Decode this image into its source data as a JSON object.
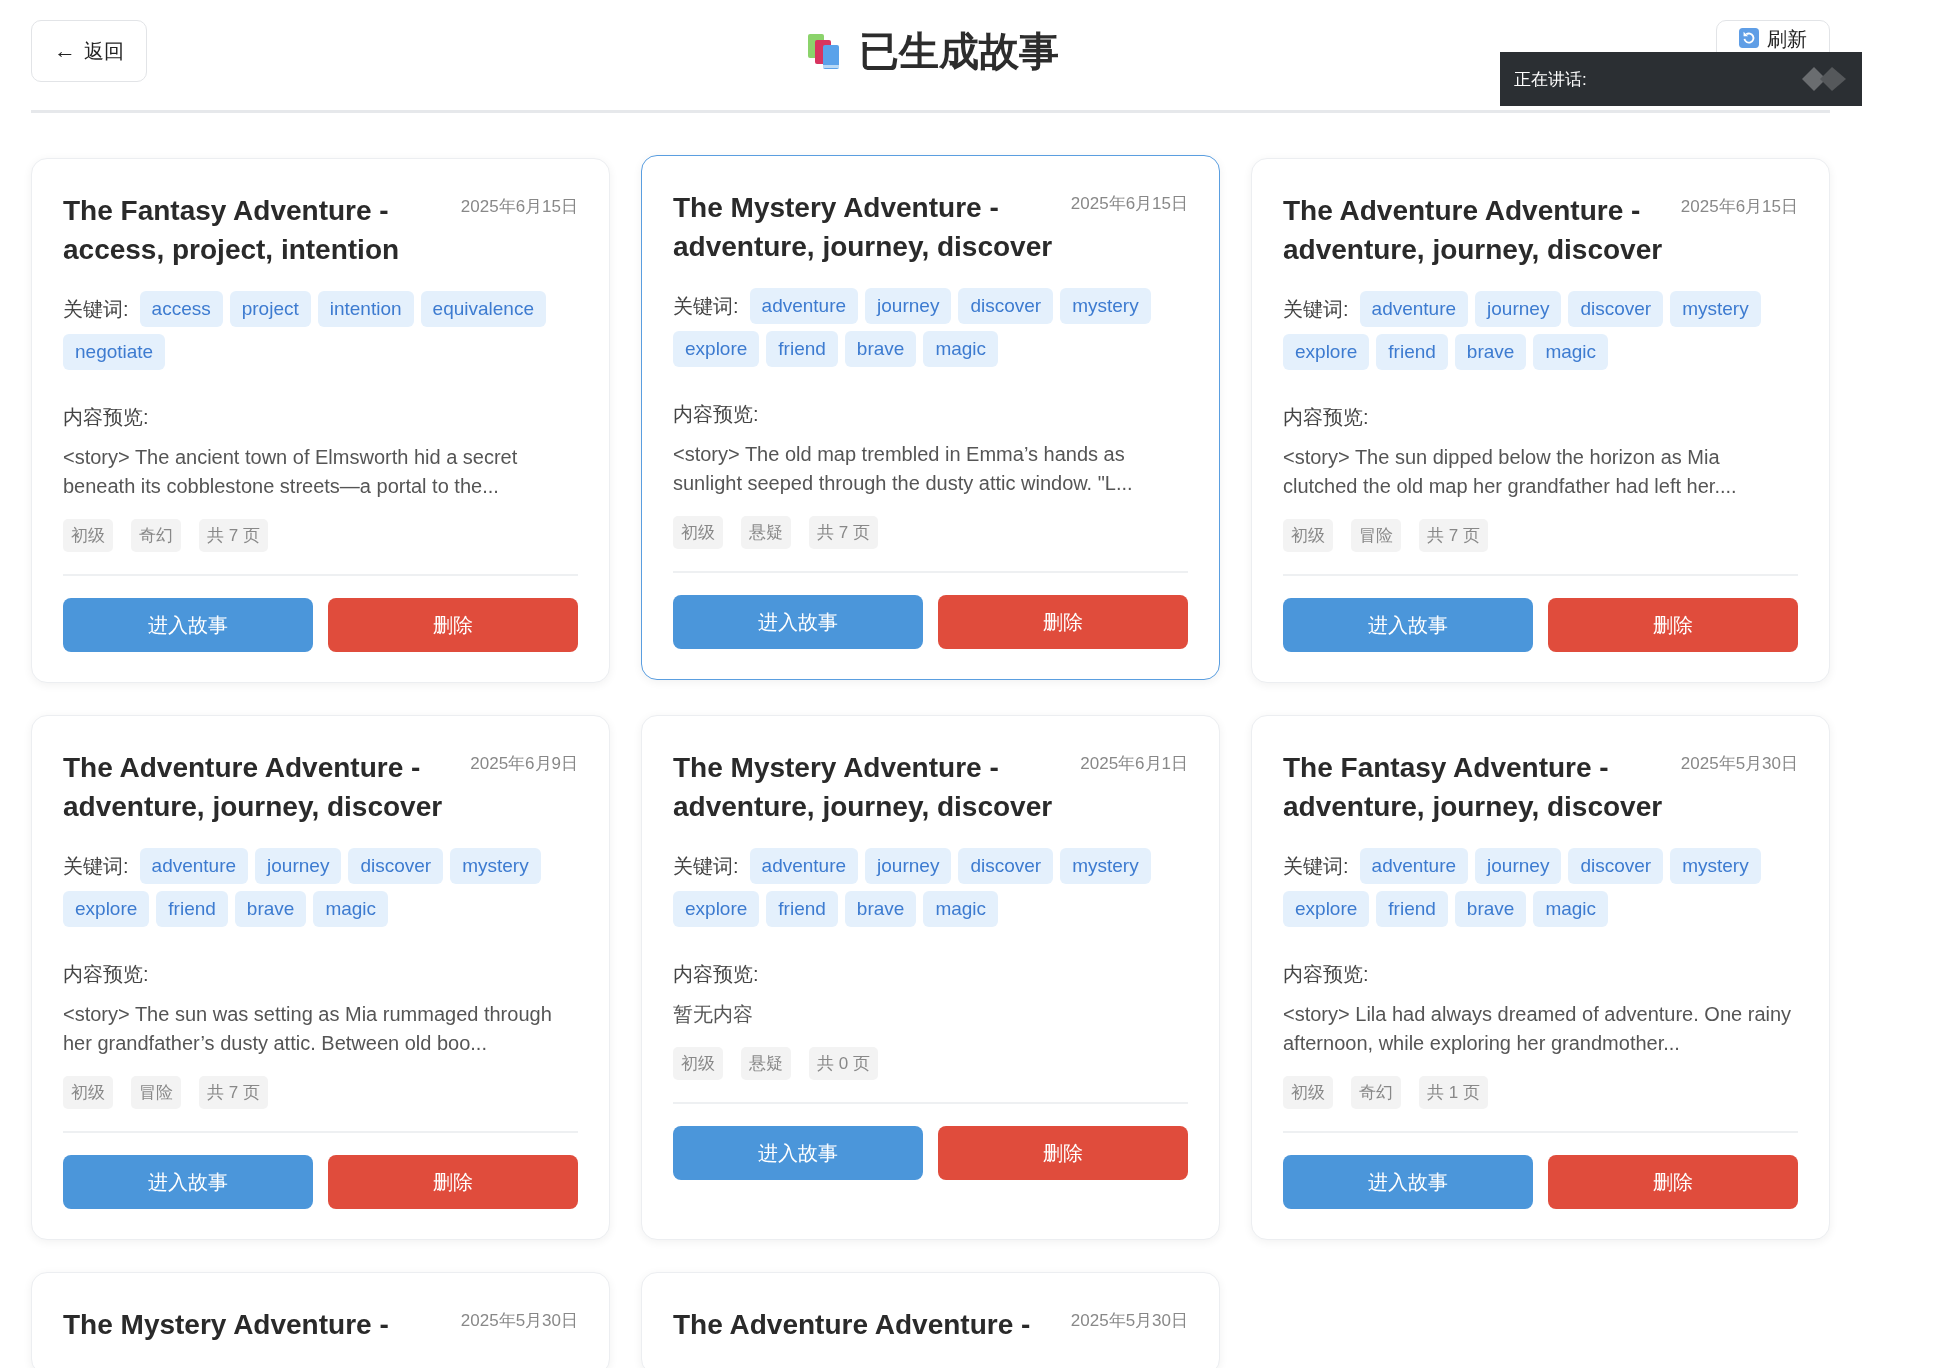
{
  "header": {
    "back": {
      "arrow": "←",
      "label": "返回"
    },
    "title": "已生成故事",
    "refresh": {
      "label": "刷新"
    }
  },
  "speaking_overlay": {
    "label": "正在讲话:"
  },
  "cards": [
    {
      "title": "The Fantasy Adventure - access, project, intention",
      "date": "2025年6月15日",
      "hovered": false,
      "keywords_label": "关键词:",
      "keywords": [
        "access",
        "project",
        "intention",
        "equivalence",
        "negotiate"
      ],
      "preview_label": "内容预览:",
      "preview": "<story> The ancient town of Elmsworth hid a secret beneath its cobblestone streets—a portal to the...",
      "meta": [
        "初级",
        "奇幻",
        "共 7 页"
      ],
      "enter": "进入故事",
      "delete": "删除"
    },
    {
      "title": "The Mystery Adventure - adventure, journey, discover",
      "date": "2025年6月15日",
      "hovered": true,
      "keywords_label": "关键词:",
      "keywords": [
        "adventure",
        "journey",
        "discover",
        "mystery",
        "explore",
        "friend",
        "brave",
        "magic"
      ],
      "preview_label": "内容预览:",
      "preview": "<story> The old map trembled in Emma’s hands as sunlight seeped through the dusty attic window. \"L...",
      "meta": [
        "初级",
        "悬疑",
        "共 7 页"
      ],
      "enter": "进入故事",
      "delete": "删除"
    },
    {
      "title": "The Adventure Adventure - adventure, journey, discover",
      "date": "2025年6月15日",
      "hovered": false,
      "keywords_label": "关键词:",
      "keywords": [
        "adventure",
        "journey",
        "discover",
        "mystery",
        "explore",
        "friend",
        "brave",
        "magic"
      ],
      "preview_label": "内容预览:",
      "preview": "<story> The sun dipped below the horizon as Mia clutched the old map her grandfather had left her....",
      "meta": [
        "初级",
        "冒险",
        "共 7 页"
      ],
      "enter": "进入故事",
      "delete": "删除"
    },
    {
      "title": "The Adventure Adventure - adventure, journey, discover",
      "date": "2025年6月9日",
      "hovered": false,
      "keywords_label": "关键词:",
      "keywords": [
        "adventure",
        "journey",
        "discover",
        "mystery",
        "explore",
        "friend",
        "brave",
        "magic"
      ],
      "preview_label": "内容预览:",
      "preview": "<story> The sun was setting as Mia rummaged through her grandfather’s dusty attic. Between old boo...",
      "meta": [
        "初级",
        "冒险",
        "共 7 页"
      ],
      "enter": "进入故事",
      "delete": "删除"
    },
    {
      "title": "The Mystery Adventure - adventure, journey, discover",
      "date": "2025年6月1日",
      "hovered": false,
      "keywords_label": "关键词:",
      "keywords": [
        "adventure",
        "journey",
        "discover",
        "mystery",
        "explore",
        "friend",
        "brave",
        "magic"
      ],
      "preview_label": "内容预览:",
      "preview": "暂无内容",
      "meta": [
        "初级",
        "悬疑",
        "共 0 页"
      ],
      "enter": "进入故事",
      "delete": "删除"
    },
    {
      "title": "The Fantasy Adventure - adventure, journey, discover",
      "date": "2025年5月30日",
      "hovered": false,
      "keywords_label": "关键词:",
      "keywords": [
        "adventure",
        "journey",
        "discover",
        "mystery",
        "explore",
        "friend",
        "brave",
        "magic"
      ],
      "preview_label": "内容预览:",
      "preview": "<story> Lila had always dreamed of adventure. One rainy afternoon, while exploring her grandmother...",
      "meta": [
        "初级",
        "奇幻",
        "共 1 页"
      ],
      "enter": "进入故事",
      "delete": "删除"
    },
    {
      "title": "The Mystery Adventure -",
      "date": "2025年5月30日",
      "hovered": false
    },
    {
      "title": "The Adventure Adventure -",
      "date": "2025年5月30日",
      "hovered": false
    }
  ]
}
